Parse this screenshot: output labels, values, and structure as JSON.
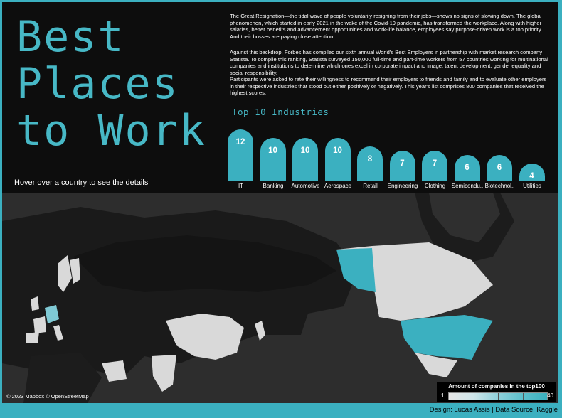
{
  "title_lines": [
    "Best",
    "Places",
    "to Work"
  ],
  "hover_hint": "Hover over a country to see the details",
  "paragraphs": [
    "The Great Resignation—the tidal wave of people voluntarily resigning from their jobs—shows no signs of slowing down. The global phenomenon, which started in early 2021 in the wake of the Covid-19 pandemic, has transformed the workplace. Along with higher salaries, better benefits and advancement opportunities and work-life balance, employees say purpose-driven work is a top priority. And their bosses are paying close attention.",
    "Against this backdrop, Forbes has compiled our sixth annual World's Best Employers in partnership with market research company Statista. To compile this ranking, Statista surveyed 150,000 full-time and part-time workers from 57 countries working for multinational companies and institutions to determine which ones excel in corporate impact and image, talent development, gender equality and social responsibility.",
    "Participants were asked to rate their willingness to recommend their employers to friends and family and to evaluate other employers in their respective industries that stood out either positively or negatively. This year's list comprises 800 companies that received the highest scores."
  ],
  "industries": {
    "title": "Top 10 Industries",
    "bar_color": "#3bb0c0",
    "items": [
      {
        "label": "IT",
        "value": 12
      },
      {
        "label": "Banking",
        "value": 10
      },
      {
        "label": "Automotive",
        "value": 10
      },
      {
        "label": "Aerospace",
        "value": 10
      },
      {
        "label": "Retail",
        "value": 8
      },
      {
        "label": "Engineering",
        "value": 7
      },
      {
        "label": "Clothing",
        "value": 7
      },
      {
        "label": "Semicondu..",
        "value": 6
      },
      {
        "label": "Biotechnol..",
        "value": 6
      },
      {
        "label": "Utilities",
        "value": 4
      }
    ]
  },
  "map": {
    "credit": "© 2023 Mapbox © OpenStreetMap",
    "legend_title": "Amount of companies in the top100",
    "legend_min": "1",
    "legend_max": "40",
    "highlight_color": "#3bb0c0",
    "land_color": "#d9d9d9"
  },
  "footer": "Design: Lucas Assis | Data Source: Kaggle"
}
